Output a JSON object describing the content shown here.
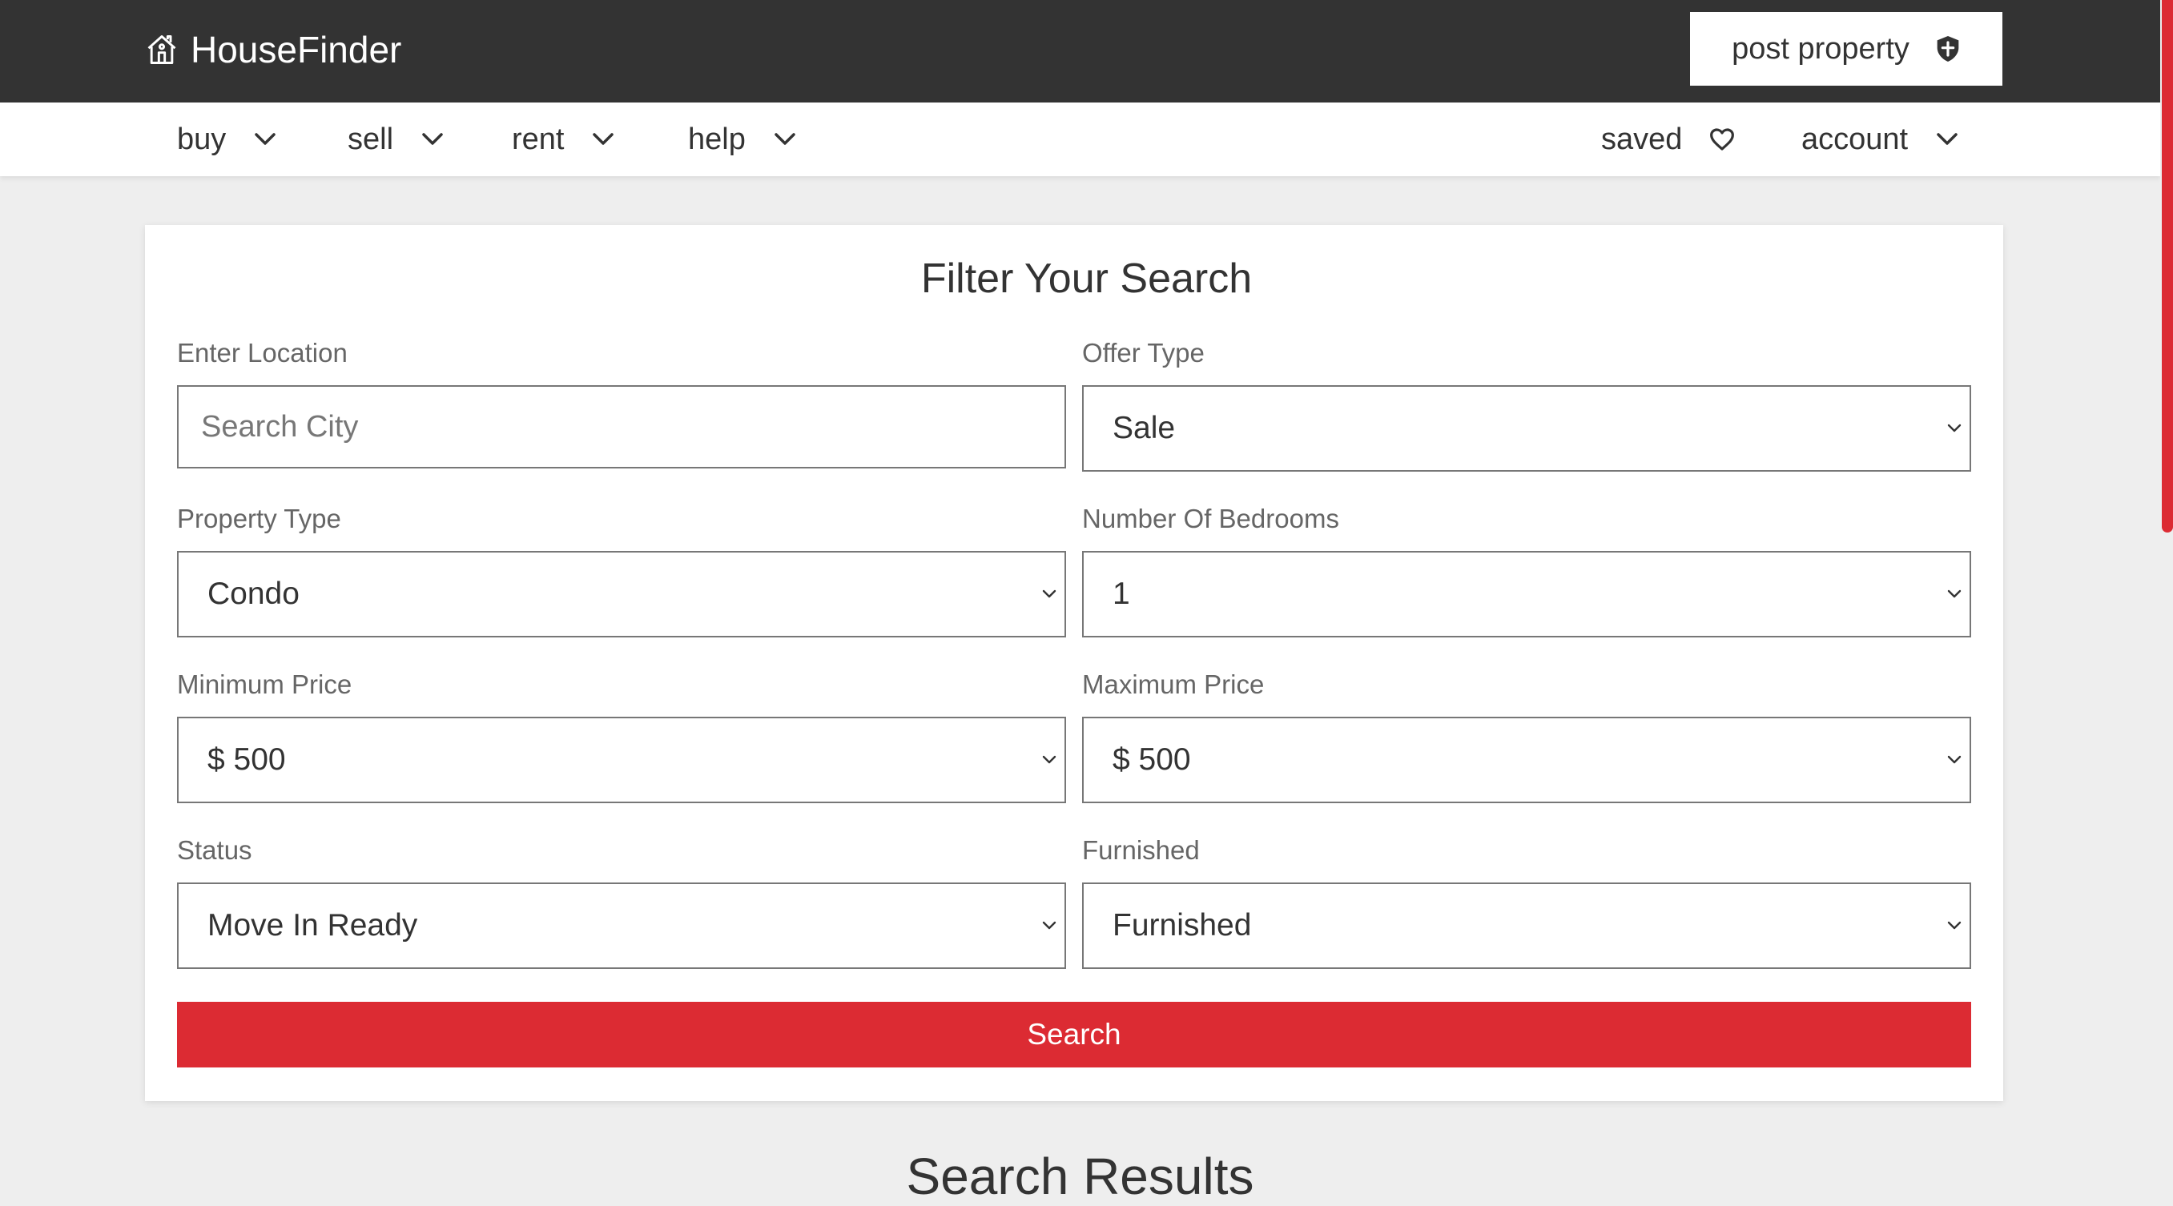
{
  "header": {
    "logo_text": "HouseFinder",
    "logo_icon": "house-icon",
    "post_property_label": "post property",
    "post_property_icon": "shield-icon"
  },
  "nav": {
    "left": [
      {
        "label": "buy"
      },
      {
        "label": "sell"
      },
      {
        "label": "rent"
      },
      {
        "label": "help"
      }
    ],
    "saved_label": "saved",
    "account_label": "account"
  },
  "filter": {
    "title": "Filter Your Search",
    "location_label": "Enter Location",
    "location_placeholder": "Search City",
    "location_value": "",
    "offer_type_label": "Offer Type",
    "offer_type_value": "Sale",
    "property_type_label": "Property Type",
    "property_type_value": "Condo",
    "bedrooms_label": "Number Of Bedrooms",
    "bedrooms_value": "1",
    "min_price_label": "Minimum Price",
    "min_price_value": "$ 500",
    "max_price_label": "Maximum Price",
    "max_price_value": "$ 500",
    "status_label": "Status",
    "status_value": "Move In Ready",
    "furnished_label": "Furnished",
    "furnished_value": "Furnished",
    "search_label": "Search"
  },
  "results": {
    "title": "Search Results"
  },
  "colors": {
    "header_bg": "#333333",
    "accent": "#dc2b33",
    "page_bg": "#eeeeee"
  }
}
